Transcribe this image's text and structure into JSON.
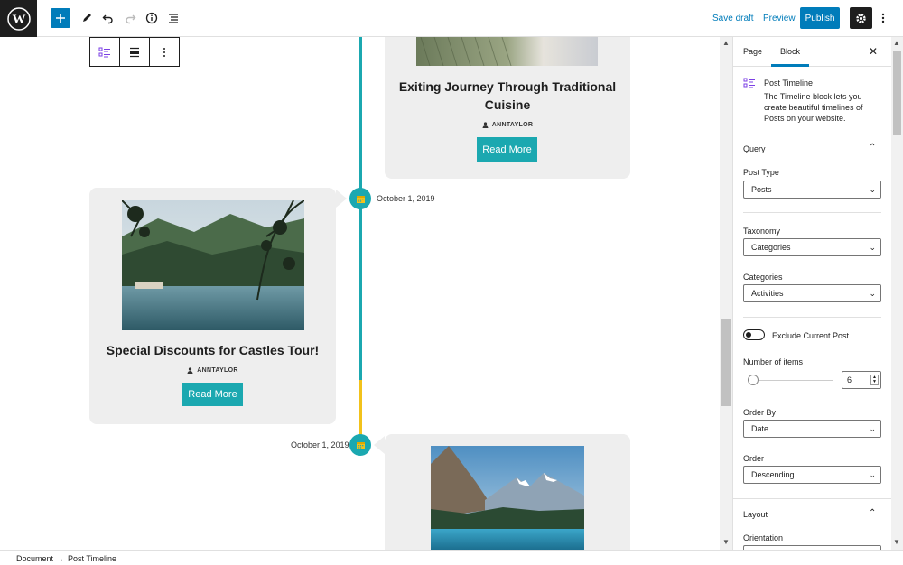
{
  "topbar": {
    "save_draft": "Save draft",
    "preview": "Preview",
    "publish": "Publish"
  },
  "timeline": {
    "accent_color": "#1ba8b0",
    "accent_color_2": "#f2c21b",
    "posts": [
      {
        "title": "Exiting Journey Through Traditional Cuisine",
        "author": "ANNTAYLOR",
        "read_more": "Read More"
      },
      {
        "date": "October 1, 2019",
        "title": "Special Discounts for Castles Tour!",
        "author": "ANNTAYLOR",
        "read_more": "Read More"
      },
      {
        "date": "October 1, 2019"
      }
    ]
  },
  "sidebar": {
    "tabs": [
      "Page",
      "Block"
    ],
    "active_tab": "Block",
    "block": {
      "title": "Post Timeline",
      "description": "The Timeline block lets you create beautiful timelines of Posts on your website."
    },
    "query": {
      "title": "Query",
      "post_type_label": "Post Type",
      "post_type_value": "Posts",
      "taxonomy_label": "Taxonomy",
      "taxonomy_value": "Categories",
      "categories_label": "Categories",
      "categories_value": "Activities",
      "exclude_label": "Exclude Current Post",
      "number_label": "Number of items",
      "number_value": "6",
      "order_by_label": "Order By",
      "order_by_value": "Date",
      "order_label": "Order",
      "order_value": "Descending"
    },
    "layout": {
      "title": "Layout",
      "orientation_label": "Orientation"
    }
  },
  "footer": {
    "crumbs": [
      "Document",
      "Post Timeline"
    ],
    "separator": "→"
  }
}
